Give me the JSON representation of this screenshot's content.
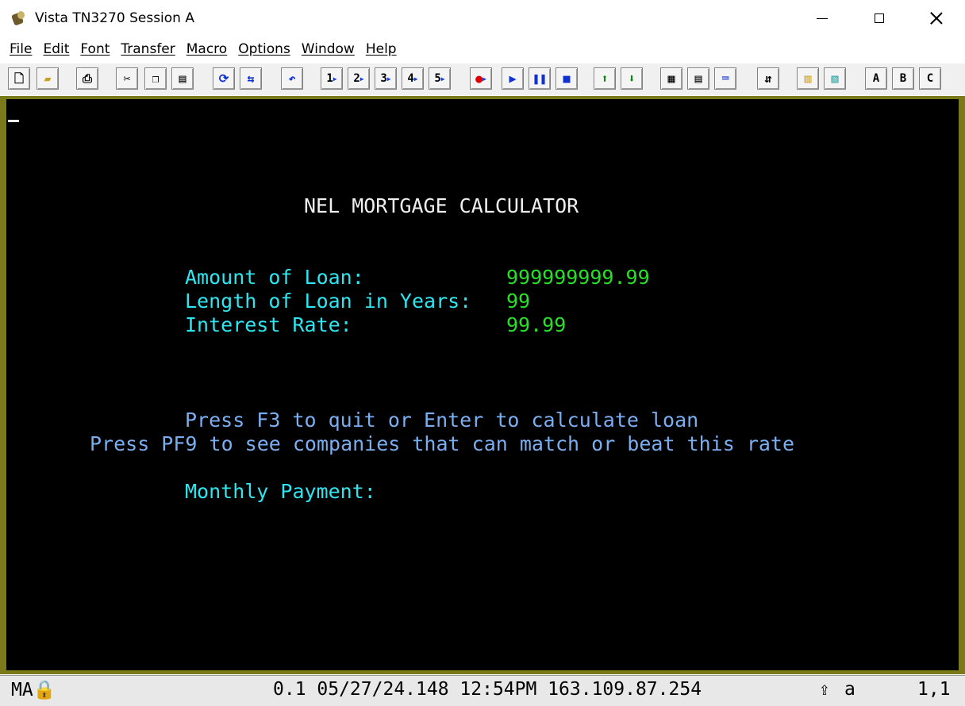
{
  "window": {
    "title": "Vista TN3270 Session A"
  },
  "menu": [
    "File",
    "Edit",
    "Font",
    "Transfer",
    "Macro",
    "Options",
    "Window",
    "Help"
  ],
  "toolbar": {
    "icons": [
      "new-document-icon",
      "open-folder-icon",
      "print-icon",
      "cut-icon",
      "copy-icon",
      "paste-icon",
      "reconnect-icon",
      "disconnect-icon",
      "undo-icon",
      "macro-1-icon",
      "macro-2-icon",
      "macro-3-icon",
      "macro-4-icon",
      "macro-5-icon",
      "record-icon",
      "play-icon",
      "pause-icon",
      "stop-icon",
      "page-up-icon",
      "page-down-icon",
      "properties-icon",
      "session-settings-icon",
      "keyboard-map-icon",
      "file-transfer-icon",
      "clipboard-icon",
      "notebook-icon",
      "session-a-icon",
      "session-b-icon",
      "session-c-icon"
    ],
    "macro_labels": [
      "1",
      "2",
      "3",
      "4",
      "5"
    ],
    "session_labels": [
      "A",
      "B",
      "C"
    ]
  },
  "screen": {
    "title": "NEL MORTGAGE CALCULATOR",
    "fields": [
      {
        "label": "Amount of Loan:",
        "value": "999999999.99"
      },
      {
        "label": "Length of Loan in Years:",
        "value": "99"
      },
      {
        "label": "Interest Rate:",
        "value": "99.99"
      }
    ],
    "instruction_1": "Press F3 to quit or Enter to calculate loan",
    "instruction_2": "Press PF9 to see companies that can match or beat this rate",
    "monthly_payment_label": "Monthly Payment:"
  },
  "status": {
    "mode": "MA",
    "info": "0.1 05/27/24.148 12:54PM 163.109.87.254",
    "input_mode": "a",
    "cursor_pos": "1,1"
  },
  "colors": {
    "screen_bg": "#000000",
    "title_text": "#f0f0f0",
    "label_text": "#2ee6f0",
    "value_text": "#28e028",
    "instruction_text": "#7aaef0",
    "frame": "#7a7a1a"
  }
}
